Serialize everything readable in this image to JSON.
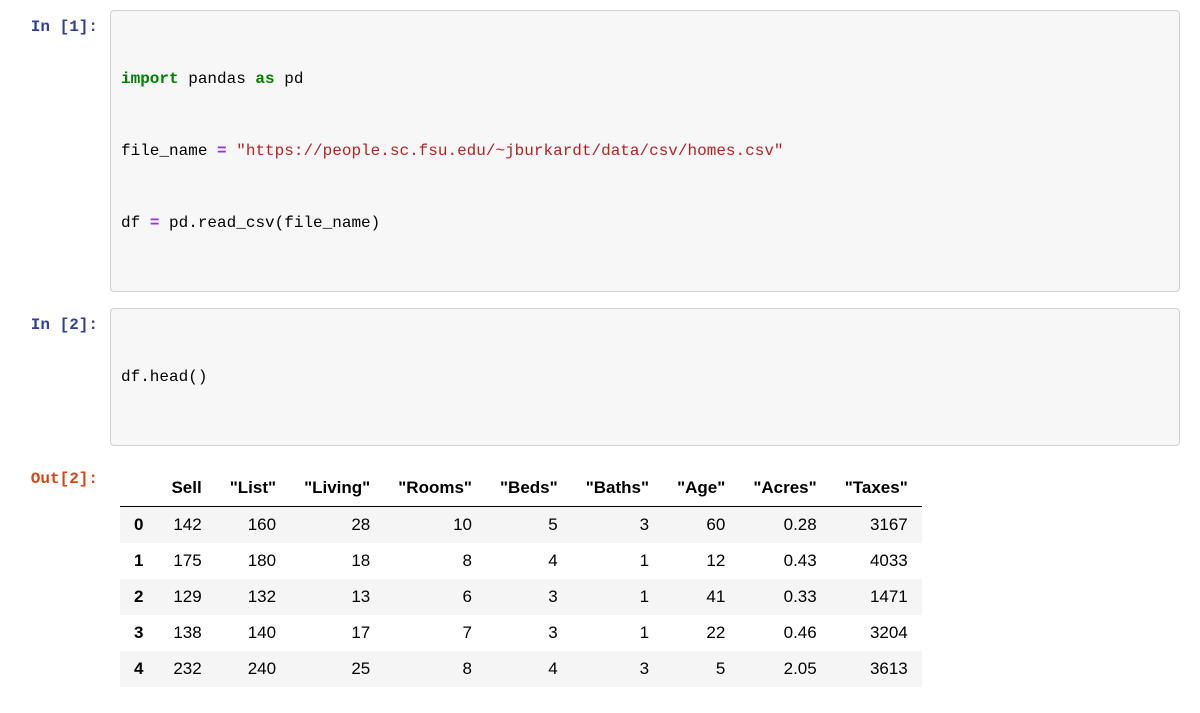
{
  "cells": {
    "in1": {
      "prompt_label": "In [1]:",
      "code": {
        "line1": {
          "t1": "import",
          "t2": " pandas ",
          "t3": "as",
          "t4": " pd"
        },
        "line2": {
          "t1": "file_name ",
          "t2": "=",
          "t3": " ",
          "t4": "\"https://people.sc.fsu.edu/~jburkardt/data/csv/homes.csv\""
        },
        "line3": {
          "t1": "df ",
          "t2": "=",
          "t3": " pd.read_csv(file_name)"
        }
      }
    },
    "in2": {
      "prompt_label": "In [2]:",
      "code": {
        "line1": {
          "t1": "df.head()"
        }
      }
    },
    "out2": {
      "prompt_label": "Out[2]:",
      "table": {
        "columns": [
          "Sell",
          "\"List\"",
          "\"Living\"",
          "\"Rooms\"",
          "\"Beds\"",
          "\"Baths\"",
          "\"Age\"",
          "\"Acres\"",
          "\"Taxes\""
        ],
        "index": [
          "0",
          "1",
          "2",
          "3",
          "4"
        ],
        "rows": [
          [
            "142",
            "160",
            "28",
            "10",
            "5",
            "3",
            "60",
            "0.28",
            "3167"
          ],
          [
            "175",
            "180",
            "18",
            "8",
            "4",
            "1",
            "12",
            "0.43",
            "4033"
          ],
          [
            "129",
            "132",
            "13",
            "6",
            "3",
            "1",
            "41",
            "0.33",
            "1471"
          ],
          [
            "138",
            "140",
            "17",
            "7",
            "3",
            "1",
            "22",
            "0.46",
            "3204"
          ],
          [
            "232",
            "240",
            "25",
            "8",
            "4",
            "3",
            "5",
            "2.05",
            "3613"
          ]
        ]
      }
    }
  }
}
